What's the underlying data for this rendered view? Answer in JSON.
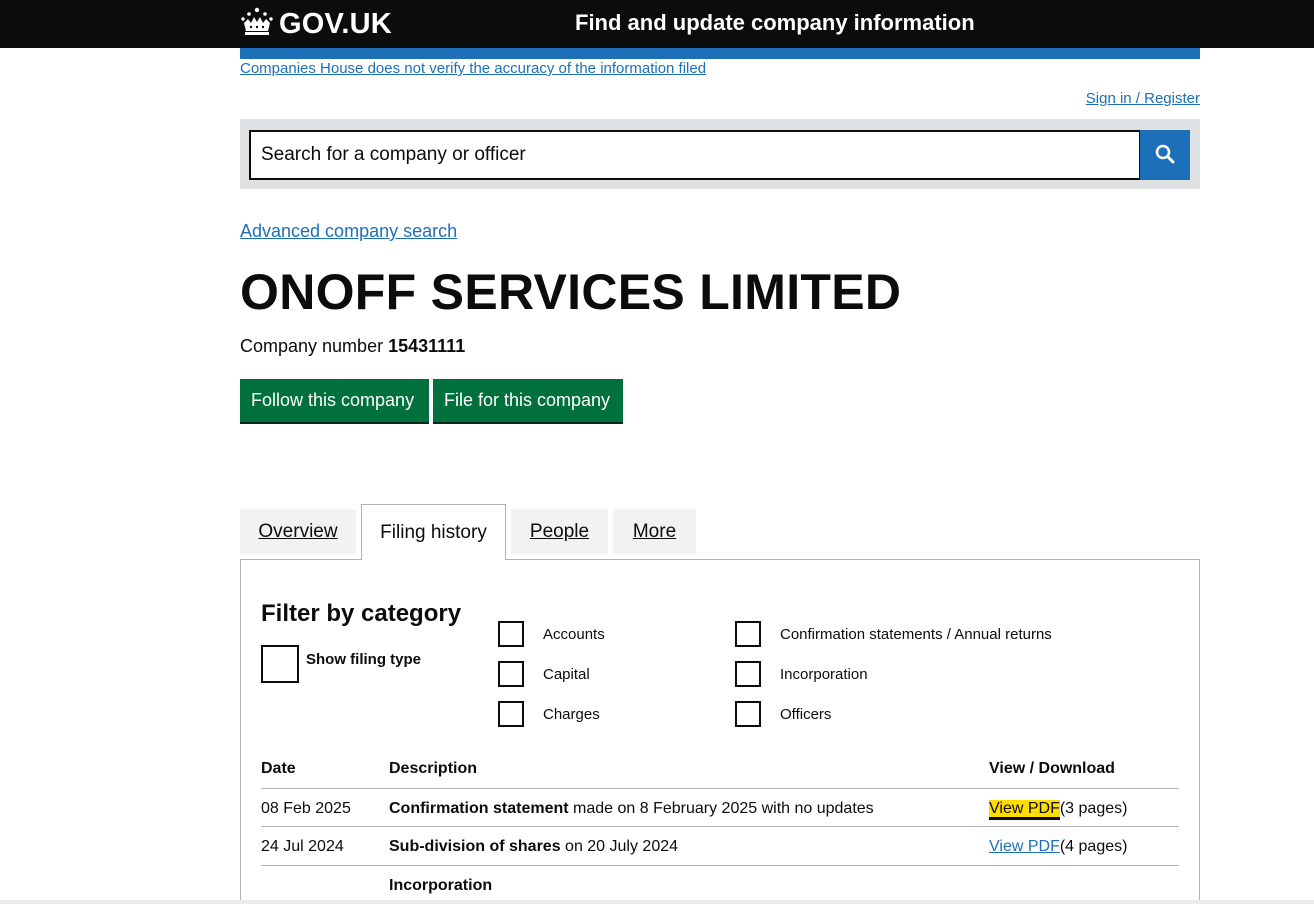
{
  "header": {
    "logo_text": "GOV.UK",
    "logo_icon": "crown-icon",
    "service_name": "Find and update company information"
  },
  "disclaimer_link": "Companies House does not verify the accuracy of the information filed",
  "signin_link": "Sign in / Register",
  "search": {
    "placeholder": "Search for a company or officer",
    "button_icon": "search-icon"
  },
  "advanced_search_link": "Advanced company search",
  "company": {
    "name": "ONOFF SERVICES LIMITED",
    "number_label": "Company number",
    "number": "15431111"
  },
  "actions": {
    "follow": "Follow this company",
    "file": "File for this company"
  },
  "tabs": [
    {
      "label": "Overview",
      "active": false
    },
    {
      "label": "Filing history",
      "active": true
    },
    {
      "label": "People",
      "active": false
    },
    {
      "label": "More",
      "active": false
    }
  ],
  "filter": {
    "title": "Filter by category",
    "show_filing_type": "Show filing type",
    "categories": [
      "Accounts",
      "Capital",
      "Charges",
      "Confirmation statements / Annual returns",
      "Incorporation",
      "Officers"
    ]
  },
  "table": {
    "headers": {
      "date": "Date",
      "description": "Description",
      "view": "View / Download"
    },
    "rows": [
      {
        "date": "08 Feb 2025",
        "desc_bold": "Confirmation statement",
        "desc_rest": " made on 8 February 2025 with no updates",
        "link": "View PDF",
        "pages": "(3 pages)"
      },
      {
        "date": "24 Jul 2024",
        "desc_bold": "Sub-division of shares",
        "desc_rest": " on 20 July 2024",
        "link": "View PDF",
        "pages": "(4 pages)"
      },
      {
        "date": "",
        "desc_bold": "Incorporation",
        "desc_rest": "",
        "link": "",
        "pages": ""
      }
    ]
  },
  "colors": {
    "header_bg": "#0b0c0c",
    "brand_blue": "#1d70b8",
    "button_green": "#00703c",
    "focus_yellow": "#ffdd00"
  }
}
